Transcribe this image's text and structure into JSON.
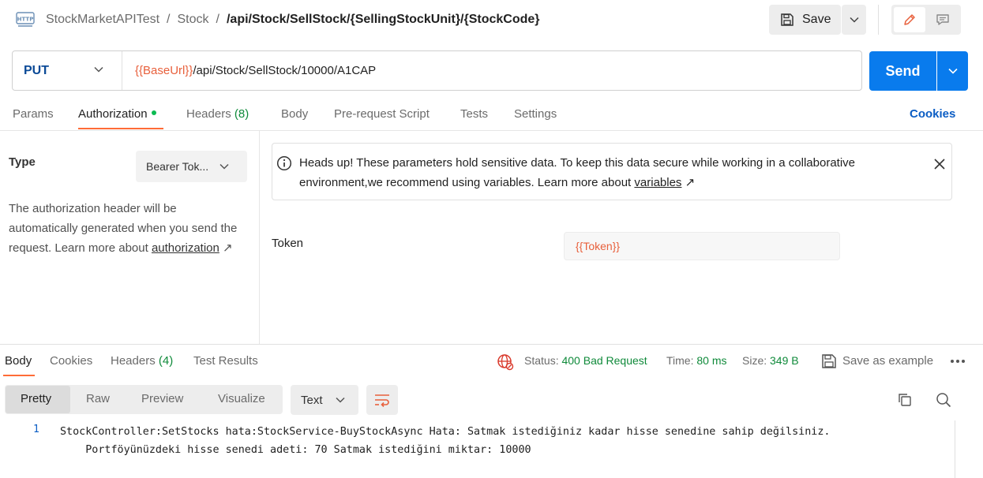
{
  "header": {
    "icon": "http-icon",
    "breadcrumb": [
      "StockMarketAPITest",
      "Stock"
    ],
    "breadcrumb_sep": "/",
    "request_name": "/api/Stock/SellStock/{SellingStockUnit}/{StockCode}",
    "save_label": "Save"
  },
  "request": {
    "method": "PUT",
    "url_var": "{{BaseUrl}}",
    "url_path": "/api/Stock/SellStock/10000/A1CAP",
    "send_label": "Send"
  },
  "tabs": {
    "params": "Params",
    "authorization": "Authorization",
    "headers": "Headers",
    "headers_count": "(8)",
    "body": "Body",
    "prerequest": "Pre-request Script",
    "tests": "Tests",
    "settings": "Settings",
    "cookies": "Cookies"
  },
  "auth": {
    "type_label": "Type",
    "type_value": "Bearer Tok...",
    "description": "The authorization header will be automatically generated when you send the request. Learn more about",
    "description_link": "authorization",
    "link_arrow": "↗",
    "notice_text": "Heads up! These parameters hold sensitive data. To keep this data secure while working in a collaborative environment,we recommend using variables. Learn more about",
    "notice_link": "variables",
    "token_label": "Token",
    "token_value": "{{Token}}"
  },
  "response": {
    "tabs": {
      "body": "Body",
      "cookies": "Cookies",
      "headers": "Headers",
      "headers_count": "(4)",
      "test_results": "Test Results"
    },
    "status_label": "Status:",
    "status_value": "400 Bad Request",
    "time_label": "Time:",
    "time_value": "80 ms",
    "size_label": "Size:",
    "size_value": "349 B",
    "save_example": "Save as example",
    "formats": [
      "Pretty",
      "Raw",
      "Preview",
      "Visualize"
    ],
    "content_type": "Text",
    "line_number": "1",
    "body_line1": "StockController:SetStocks hata:StockService-BuyStockAsync Hata: Satmak istediğiniz kadar hisse senedine sahip değilsiniz.",
    "body_line2": "    Portföyünüzdeki hisse senedi adeti: 70 Satmak istediğini miktar: 10000"
  },
  "colors": {
    "accent_orange": "#ff6c37",
    "send_blue": "#097bed",
    "method_blue": "#0b4a97",
    "variable_orange": "#e8603c",
    "success_green": "#0f8a3a"
  }
}
